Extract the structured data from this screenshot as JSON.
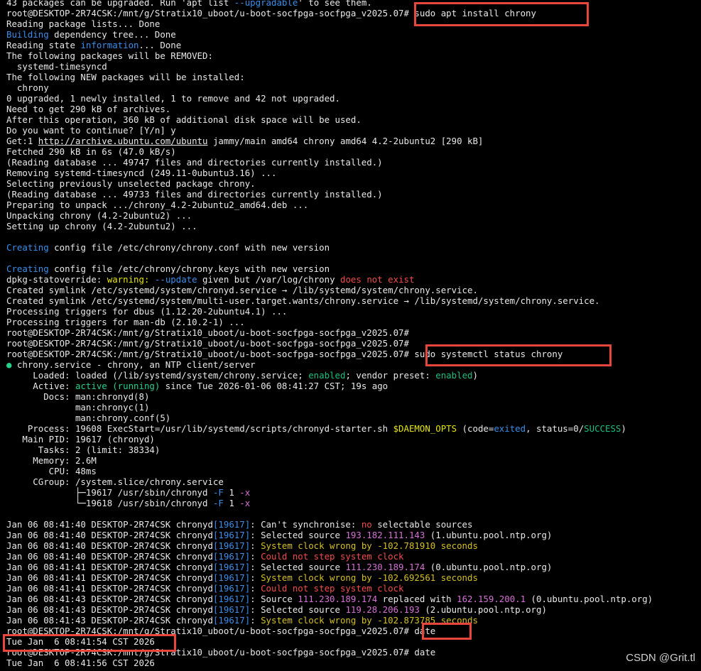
{
  "terminal": {
    "lines": [
      [
        [
          "43 packages can be upgraded. Run 'apt list ",
          "t"
        ],
        [
          "--upgradable",
          "cyan"
        ],
        [
          "' to see them.",
          "t"
        ]
      ],
      [
        [
          "root@DESKTOP-2R74CSK:/mnt/g/Stratix10_uboot/u-boot-socfpga-socfpga_v2025.07# sudo apt install chrony",
          "t"
        ]
      ],
      [
        [
          "Reading package lists... Done",
          "t"
        ]
      ],
      [
        [
          "Building",
          "cyan"
        ],
        [
          " dependency tree... Done",
          "t"
        ]
      ],
      [
        [
          "Reading state ",
          "t"
        ],
        [
          "information",
          "cyan"
        ],
        [
          "... Done",
          "t"
        ]
      ],
      [
        [
          "The following packages will be REMOVED:",
          "t"
        ]
      ],
      [
        [
          "  systemd-timesyncd",
          "t"
        ]
      ],
      [
        [
          "The following NEW packages will be installed:",
          "t"
        ]
      ],
      [
        [
          "  chrony",
          "t"
        ]
      ],
      [
        [
          "0 upgraded, 1 newly installed, 1 to remove and 42 not upgraded.",
          "t"
        ]
      ],
      [
        [
          "Need to get 290 kB of archives.",
          "t"
        ]
      ],
      [
        [
          "After this operation, 360 kB of additional disk space will be used.",
          "t"
        ]
      ],
      [
        [
          "Do you want to continue? [Y/n] y",
          "t"
        ]
      ],
      [
        [
          "Get:1 ",
          "t"
        ],
        [
          "http://archive.ubuntu.com/ubuntu",
          "link"
        ],
        [
          " jammy/main amd64 chrony amd64 4.2-2ubuntu2 [290 kB]",
          "t"
        ]
      ],
      [
        [
          "Fetched 290 kB in 6s (47.0 kB/s)",
          "t"
        ]
      ],
      [
        [
          "(Reading database ... 49747 files and directories currently installed.)",
          "t"
        ]
      ],
      [
        [
          "Removing systemd-timesyncd (249.11-0ubuntu3.16) ...",
          "t"
        ]
      ],
      [
        [
          "Selecting previously unselected package chrony.",
          "t"
        ]
      ],
      [
        [
          "(Reading database ... 49733 files and directories currently installed.)",
          "t"
        ]
      ],
      [
        [
          "Preparing to unpack .../chrony_4.2-2ubuntu2_amd64.deb ...",
          "t"
        ]
      ],
      [
        [
          "Unpacking chrony (4.2-2ubuntu2) ...",
          "t"
        ]
      ],
      [
        [
          "Setting up chrony (4.2-2ubuntu2) ...",
          "t"
        ]
      ],
      [
        [
          "",
          "t"
        ]
      ],
      [
        [
          "Creating",
          "cyan"
        ],
        [
          " config file /etc/chrony/chrony.conf with new version",
          "t"
        ]
      ],
      [
        [
          "",
          "t"
        ]
      ],
      [
        [
          "Creating",
          "cyan"
        ],
        [
          " config file /etc/chrony/chrony.keys with new version",
          "t"
        ]
      ],
      [
        [
          "dpkg-statoverride: ",
          "t"
        ],
        [
          "warning:",
          "yellow"
        ],
        [
          " ",
          "t"
        ],
        [
          "--update",
          "cyan"
        ],
        [
          " given but /var/log/chrony ",
          "t"
        ],
        [
          "does not exist",
          "red"
        ]
      ],
      [
        [
          "Created symlink /etc/systemd/system/chronyd.service → /lib/systemd/system/chrony.service.",
          "t"
        ]
      ],
      [
        [
          "Created symlink /etc/systemd/system/multi-user.target.wants/chrony.service → /lib/systemd/system/chrony.service.",
          "t"
        ]
      ],
      [
        [
          "Processing triggers for dbus (1.12.20-2ubuntu4.1) ...",
          "t"
        ]
      ],
      [
        [
          "Processing triggers for man-db (2.10.2-1) ...",
          "t"
        ]
      ],
      [
        [
          "root@DESKTOP-2R74CSK:/mnt/g/Stratix10_uboot/u-boot-socfpga-socfpga_v2025.07#",
          "t"
        ]
      ],
      [
        [
          "root@DESKTOP-2R74CSK:/mnt/g/Stratix10_uboot/u-boot-socfpga-socfpga_v2025.07#",
          "t"
        ]
      ],
      [
        [
          "root@DESKTOP-2R74CSK:/mnt/g/Stratix10_uboot/u-boot-socfpga-socfpga_v2025.07# sudo systemctl status chrony",
          "t"
        ]
      ],
      [
        [
          "●",
          "green"
        ],
        [
          " chrony.service - chrony, an NTP client/server",
          "t"
        ]
      ],
      [
        [
          "     Loaded: loaded (/lib/systemd/system/chrony.service; ",
          "t"
        ],
        [
          "enabled",
          "green2"
        ],
        [
          "; vendor preset: ",
          "t"
        ],
        [
          "enabled",
          "green2"
        ],
        [
          ")",
          "t"
        ]
      ],
      [
        [
          "     Active: ",
          "t"
        ],
        [
          "active (running)",
          "green"
        ],
        [
          " since Tue 2026-01-06 08:41:27 CST; 19s ago",
          "t"
        ]
      ],
      [
        [
          "       Docs: man:chronyd(8)",
          "t"
        ]
      ],
      [
        [
          "             man:chronyc(1)",
          "t"
        ]
      ],
      [
        [
          "             man:chrony.conf(5)",
          "t"
        ]
      ],
      [
        [
          "    Process: 19608 ExecStart=/usr/lib/systemd/scripts/chronyd-starter.sh ",
          "t"
        ],
        [
          "$DAEMON_OPTS",
          "yellow"
        ],
        [
          " (code=",
          "t"
        ],
        [
          "exited",
          "cyan"
        ],
        [
          ", status=0/",
          "t"
        ],
        [
          "SUCCESS",
          "green2"
        ],
        [
          ")",
          "t"
        ]
      ],
      [
        [
          "   Main PID: 19617 (chronyd)",
          "t"
        ]
      ],
      [
        [
          "      Tasks: 2 (limit: 38334)",
          "t"
        ]
      ],
      [
        [
          "     Memory: 2.6M",
          "t"
        ]
      ],
      [
        [
          "        CPU: 48ms",
          "t"
        ]
      ],
      [
        [
          "     CGroup: /system.slice/chrony.service",
          "t"
        ]
      ],
      [
        [
          "             ├─19617 /usr/sbin/chronyd ",
          "t"
        ],
        [
          "-F",
          "cyan"
        ],
        [
          " 1 ",
          "t"
        ],
        [
          "-x",
          "magenta"
        ]
      ],
      [
        [
          "             └─19618 /usr/sbin/chronyd ",
          "t"
        ],
        [
          "-F",
          "cyan"
        ],
        [
          " 1 ",
          "t"
        ],
        [
          "-x",
          "magenta"
        ]
      ],
      [
        [
          "",
          "t"
        ]
      ],
      [
        [
          "Jan 06 08:41:40 DESKTOP-2R74CSK chronyd",
          "t"
        ],
        [
          "[19617]",
          "cyan"
        ],
        [
          ": Can't synchronise: ",
          "t"
        ],
        [
          "no",
          "red"
        ],
        [
          " selectable sources",
          "t"
        ]
      ],
      [
        [
          "Jan 06 08:41:40 DESKTOP-2R74CSK chronyd",
          "t"
        ],
        [
          "[19617]",
          "cyan"
        ],
        [
          ": Selected source ",
          "t"
        ],
        [
          "193.182.111.143",
          "magenta"
        ],
        [
          " (1.ubuntu.pool.ntp.org)",
          "t"
        ]
      ],
      [
        [
          "Jan 06 08:41:40 DESKTOP-2R74CSK chronyd",
          "t"
        ],
        [
          "[19617]",
          "cyan"
        ],
        [
          ": ",
          "t"
        ],
        [
          "System clock wrong by -102.781910 seconds",
          "yellow2"
        ]
      ],
      [
        [
          "Jan 06 08:41:40 DESKTOP-2R74CSK chronyd",
          "t"
        ],
        [
          "[19617]",
          "cyan"
        ],
        [
          ": ",
          "t"
        ],
        [
          "Could not step system clock",
          "red"
        ]
      ],
      [
        [
          "Jan 06 08:41:41 DESKTOP-2R74CSK chronyd",
          "t"
        ],
        [
          "[19617]",
          "cyan"
        ],
        [
          ": Selected source ",
          "t"
        ],
        [
          "111.230.189.174",
          "magenta"
        ],
        [
          " (0.ubuntu.pool.ntp.org)",
          "t"
        ]
      ],
      [
        [
          "Jan 06 08:41:41 DESKTOP-2R74CSK chronyd",
          "t"
        ],
        [
          "[19617]",
          "cyan"
        ],
        [
          ": ",
          "t"
        ],
        [
          "System clock wrong by -102.692561 seconds",
          "yellow2"
        ]
      ],
      [
        [
          "Jan 06 08:41:41 DESKTOP-2R74CSK chronyd",
          "t"
        ],
        [
          "[19617]",
          "cyan"
        ],
        [
          ": ",
          "t"
        ],
        [
          "Could not step system clock",
          "red"
        ]
      ],
      [
        [
          "Jan 06 08:41:43 DESKTOP-2R74CSK chronyd",
          "t"
        ],
        [
          "[19617]",
          "cyan"
        ],
        [
          ": Source ",
          "t"
        ],
        [
          "111.230.189.174",
          "magenta"
        ],
        [
          " replaced with ",
          "t"
        ],
        [
          "162.159.200.1",
          "magenta"
        ],
        [
          " (0.ubuntu.pool.ntp.org)",
          "t"
        ]
      ],
      [
        [
          "Jan 06 08:41:43 DESKTOP-2R74CSK chronyd",
          "t"
        ],
        [
          "[19617]",
          "cyan"
        ],
        [
          ": Selected source ",
          "t"
        ],
        [
          "119.28.206.193",
          "magenta"
        ],
        [
          " (2.ubuntu.pool.ntp.org)",
          "t"
        ]
      ],
      [
        [
          "Jan 06 08:41:43 DESKTOP-2R74CSK chronyd",
          "t"
        ],
        [
          "[19617]",
          "cyan"
        ],
        [
          ": ",
          "t"
        ],
        [
          "System clock wrong by -102.873785 seconds",
          "yellow2"
        ]
      ],
      [
        [
          "root@DESKTOP-2R74CSK:/mnt/g/Stratix10_uboot/u-boot-socfpga-socfpga_v2025.07# date",
          "t"
        ]
      ],
      [
        [
          "Tue Jan  6 08:41:54 CST 2026",
          "t"
        ]
      ],
      [
        [
          "root@DESKTOP-2R74CSK:/mnt/g/Stratix10_uboot/u-boot-socfpga-socfpga_v2025.07# date",
          "t"
        ]
      ],
      [
        [
          "Tue Jan  6 08:41:56 CST 2026",
          "t"
        ]
      ]
    ]
  },
  "watermark": "CSDN @Grit.tl",
  "colors": {
    "background": "#000000",
    "text": "#e8e8e8",
    "cyan": "#3b8eea",
    "green": "#23d18b",
    "yellow": "#e5e510",
    "red": "#f14c4c",
    "magenta": "#d670d6",
    "highlight_box": "#e8453c"
  }
}
